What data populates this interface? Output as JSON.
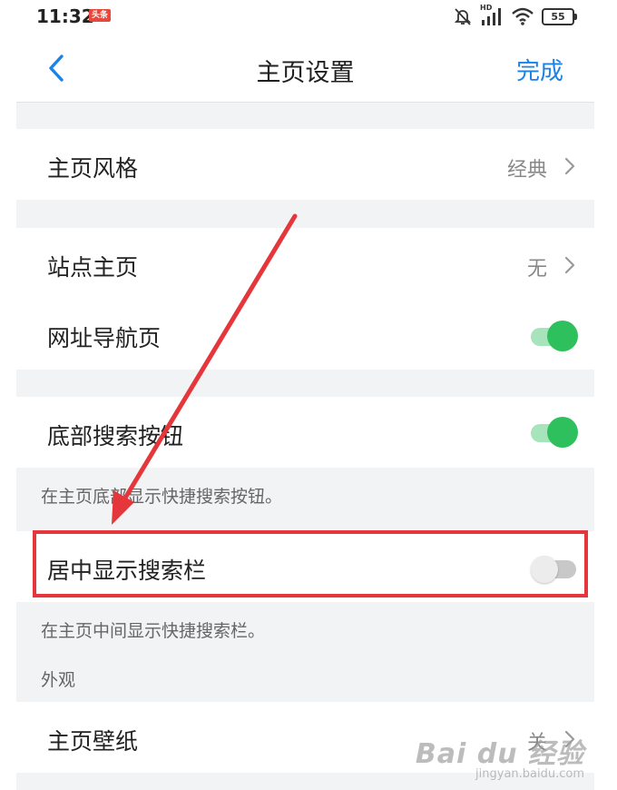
{
  "status_bar": {
    "time": "11:32",
    "app_badge": "头条",
    "network": "HD",
    "battery": "55"
  },
  "header": {
    "title": "主页设置",
    "done_label": "完成"
  },
  "settings": {
    "home_style": {
      "label": "主页风格",
      "value": "经典"
    },
    "site_home": {
      "label": "站点主页",
      "value": "无"
    },
    "url_nav": {
      "label": "网址导航页",
      "enabled": true
    },
    "bottom_search": {
      "label": "底部搜索按钮",
      "enabled": true,
      "note": "在主页底部显示快捷搜索按钮。"
    },
    "center_search": {
      "label": "居中显示搜索栏",
      "enabled": false,
      "note": "在主页中间显示快捷搜索栏。"
    },
    "appearance_section": "外观",
    "wallpaper": {
      "label": "主页壁纸",
      "value": "关"
    }
  },
  "watermark": {
    "main": "Bai du 经验",
    "sub": "jingyan.baidu.com"
  },
  "colors": {
    "accent": "#1a82e8",
    "toggle_on": "#2ec05c",
    "annotation": "#e5373b"
  }
}
